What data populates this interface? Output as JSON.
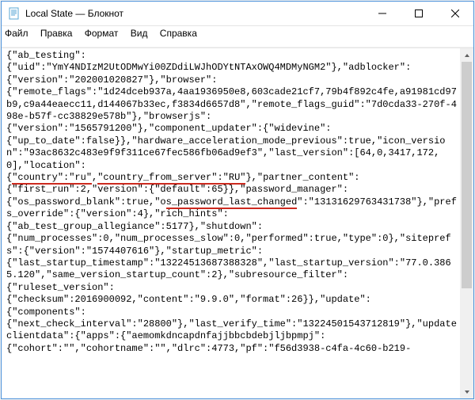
{
  "titlebar": {
    "title": "Local State — Блокнот"
  },
  "menubar": {
    "file": "Файл",
    "edit": "Правка",
    "format": "Формат",
    "view": "Вид",
    "help": "Справка"
  },
  "content": {
    "pre1": "{\"ab_testing\":\n{\"uid\":\"YmY4NDIzM2UtODMwYi00ZDdiLWJhODYtNTAxOWQ4MDMyNGM2\"},\"adblocker\":\n{\"version\":\"202001020827\"},\"browser\":\n{\"remote_flags\":\"1d24dceb937a,4aa1936950e8,603cade21cf7,79b4f892c4fe,a91981cd97b9,c9a44eaecc11,d144067b33ec,f3834d6657d8\",\"remote_flags_guid\":\"7d0cda33-270f-498e-b57f-cc38829e578b\"},\"browserjs\":\n{\"version\":\"1565791200\"},\"component_updater\":{\"widevine\":\n{\"up_to_date\":false}},\"hardware_acceleration_mode_previous\":true,\"icon_version\":\"93ac8632c483e9f9f311ce67fec586fb06ad9ef3\",\"last_version\":[64,0,3417,172,0],\"location\":\n{",
    "hl1": "\"country\":\"ru\"",
    "mid1": ",",
    "hl2": "\"country_from_server\":\"RU\"",
    "post1": "},\"partner_content\":\n{\"first_run\":2,\"version\":{\"default\":65}},\"password_manager\":\n{\"os_password_blank\":true,\"o",
    "hl3": "s_password_last_changed",
    "post2": "\":\"13131629763431738\"},\"prefs_override\":{\"version\":4},\"rich_hints\":\n{\"ab_test_group_allegiance\":5177},\"shutdown\":\n{\"num_processes\":0,\"num_processes_slow\":0,\"performed\":true,\"type\":0},\"siteprefs\":{\"version\":\"1574407616\"},\"startup_metric\":\n{\"last_startup_timestamp\":\"13224513687388328\",\"last_startup_version\":\"77.0.3865.120\",\"same_version_startup_count\":2},\"subresource_filter\":\n{\"ruleset_version\":\n{\"checksum\":2016900092,\"content\":\"9.9.0\",\"format\":26}},\"update\":\n{\"components\":\n{\"next_check_interval\":\"28800\"},\"last_verify_time\":\"13224501543712819\"},\"updateclientdata\":{\"apps\":{\"aemomkdncapdnfajjbbcbdebjljbpmpj\":\n{\"cohort\":\"\",\"cohortname\":\"\",\"dlrc\":4773,\"pf\":\"f56d3938-c4fa-4c60-b219-"
  }
}
